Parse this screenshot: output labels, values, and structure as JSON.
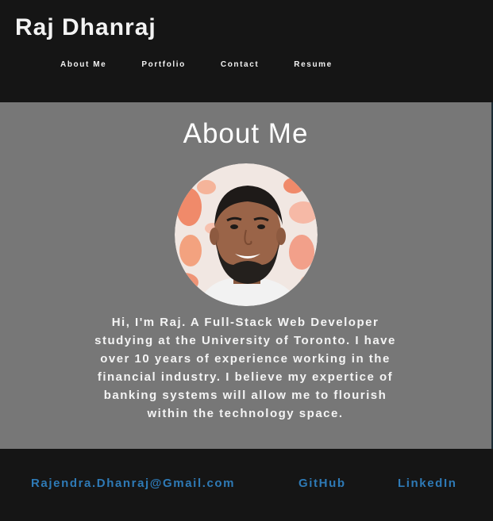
{
  "header": {
    "title": "Raj Dhanraj",
    "nav": [
      {
        "label": "About Me"
      },
      {
        "label": "Portfolio"
      },
      {
        "label": "Contact"
      },
      {
        "label": "Resume"
      }
    ]
  },
  "about": {
    "heading": "About Me",
    "photo_icon": "profile-photo",
    "bio": "Hi, I'm Raj. A Full-Stack Web Developer studying at the University of Toronto. I have over 10 years of experience working in the financial industry. I believe my expertice of banking systems will allow me to flourish within the technology space."
  },
  "footer": {
    "email": "Rajendra.Dhanraj@Gmail.com",
    "github": "GitHub",
    "linkedin": "LinkedIn"
  },
  "colors": {
    "header_bg": "#151515",
    "about_bg": "#777777",
    "footer_bg": "#151515",
    "link": "#2e7ab6",
    "text": "#ffffff"
  }
}
